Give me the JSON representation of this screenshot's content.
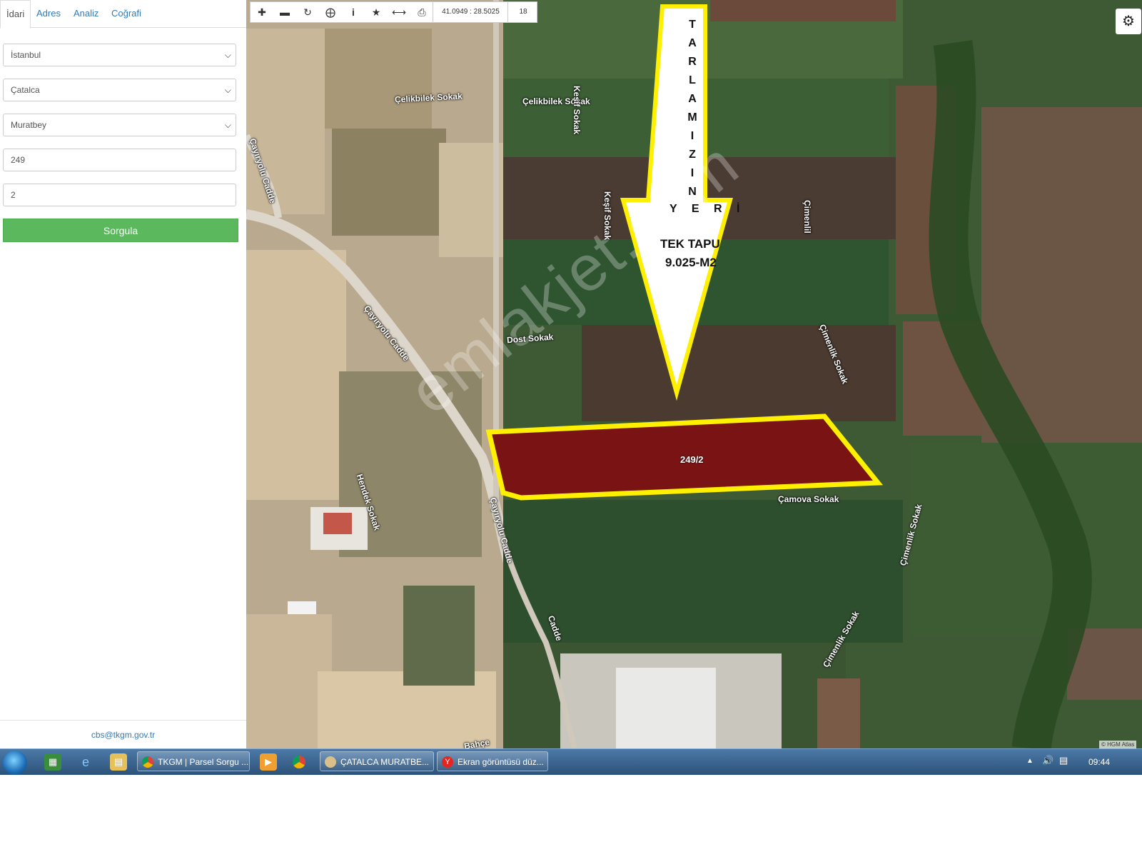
{
  "panel": {
    "tabs": [
      {
        "label": "İdari",
        "active": true
      },
      {
        "label": "Adres",
        "active": false
      },
      {
        "label": "Analiz",
        "active": false
      },
      {
        "label": "Coğrafi",
        "active": false
      }
    ],
    "il_value": "İstanbul",
    "ilce_value": "Çatalca",
    "mahalle_value": "Muratbey",
    "ada_value": "249",
    "parsel_value": "2",
    "query_label": "Sorgula",
    "footer_email": "cbs@tkgm.gov.tr"
  },
  "toolbar": {
    "icons": [
      "zoom-in-icon",
      "zoom-out-icon",
      "refresh-icon",
      "locate-icon",
      "info-icon",
      "star-icon",
      "measure-icon",
      "print-icon"
    ],
    "coordinates": "41.0949 : 28.5025",
    "zoom_level": "18"
  },
  "map": {
    "streets": [
      "Çelikbilek Sokak",
      "Çelikbilek Sokak",
      "Keşif Sokak",
      "Keşif Sokak",
      "Çimenlil",
      "Dost Sokak",
      "Çimenlik Sokak",
      "Çayıryolu Cadde",
      "Çayıryolu Cadde",
      "Çayıryolu Cadde",
      "Hendek Sokak",
      "Çamova Sokak",
      "Çimenlik Sokak",
      "Çimenlik Sokak",
      "Cadde",
      "Bahçe"
    ],
    "arrow_letters": [
      "T",
      "A",
      "R",
      "L",
      "A",
      "M",
      "I",
      "Z",
      "I",
      "N"
    ],
    "arrow_line2": "Y E R İ",
    "arrow_line3": "TEK TAPU",
    "arrow_line4": "9.025-M2",
    "parcel_label": "249/2",
    "watermark": "emlakjet.com",
    "attribution": "© HGM Atlas",
    "highlight_color": "#ffef00",
    "parcel_color": "#7a1414"
  },
  "taskbar": {
    "items": [
      {
        "label": "TKGM | Parsel Sorgu ...",
        "icon": "chrome-icon"
      },
      {
        "label": "ÇATALCA MURATBE...",
        "icon": "paint-icon"
      },
      {
        "label": "Ekran görüntüsü düz...",
        "icon": "yandex-icon"
      }
    ],
    "clock": "09:44"
  }
}
